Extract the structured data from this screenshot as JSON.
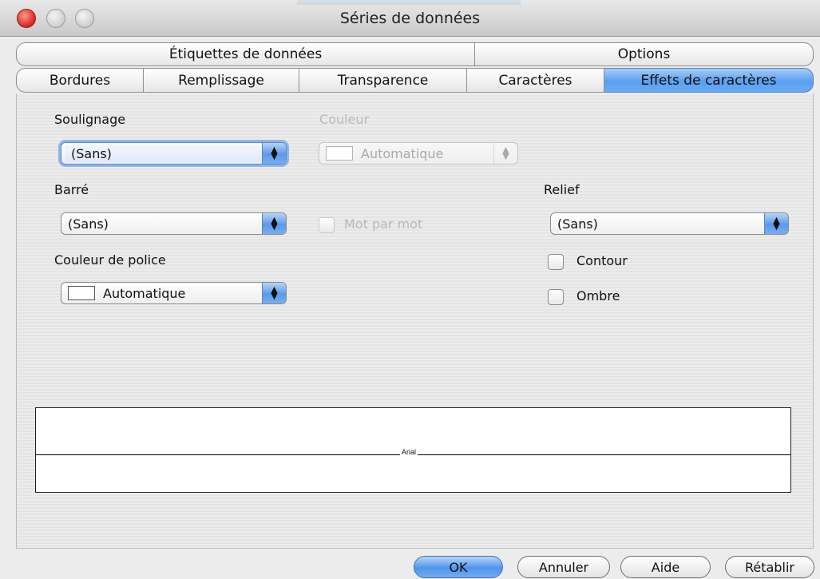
{
  "window": {
    "title": "Séries de données"
  },
  "tabs_row1": [
    {
      "label": "Étiquettes de données"
    },
    {
      "label": "Options"
    }
  ],
  "tabs_row2": [
    {
      "label": "Bordures"
    },
    {
      "label": "Remplissage"
    },
    {
      "label": "Transparence"
    },
    {
      "label": "Caractères"
    },
    {
      "label": "Effets de caractères",
      "active": true
    }
  ],
  "form": {
    "underline_label": "Soulignage",
    "underline_value": "(Sans)",
    "underline_color_label": "Couleur",
    "underline_color_value": "Automatique",
    "strike_label": "Barré",
    "strike_value": "(Sans)",
    "word_by_word_label": "Mot par mot",
    "font_color_label": "Couleur de police",
    "font_color_value": "Automatique",
    "relief_label": "Relief",
    "relief_value": "(Sans)",
    "outline_label": "Contour",
    "shadow_label": "Ombre"
  },
  "preview": {
    "sample_text": "Arial"
  },
  "buttons": {
    "ok": "OK",
    "cancel": "Annuler",
    "help": "Aide",
    "reset": "Rétablir"
  },
  "colors": {
    "accent": "#5b9ff0",
    "close": "#e2322a"
  }
}
